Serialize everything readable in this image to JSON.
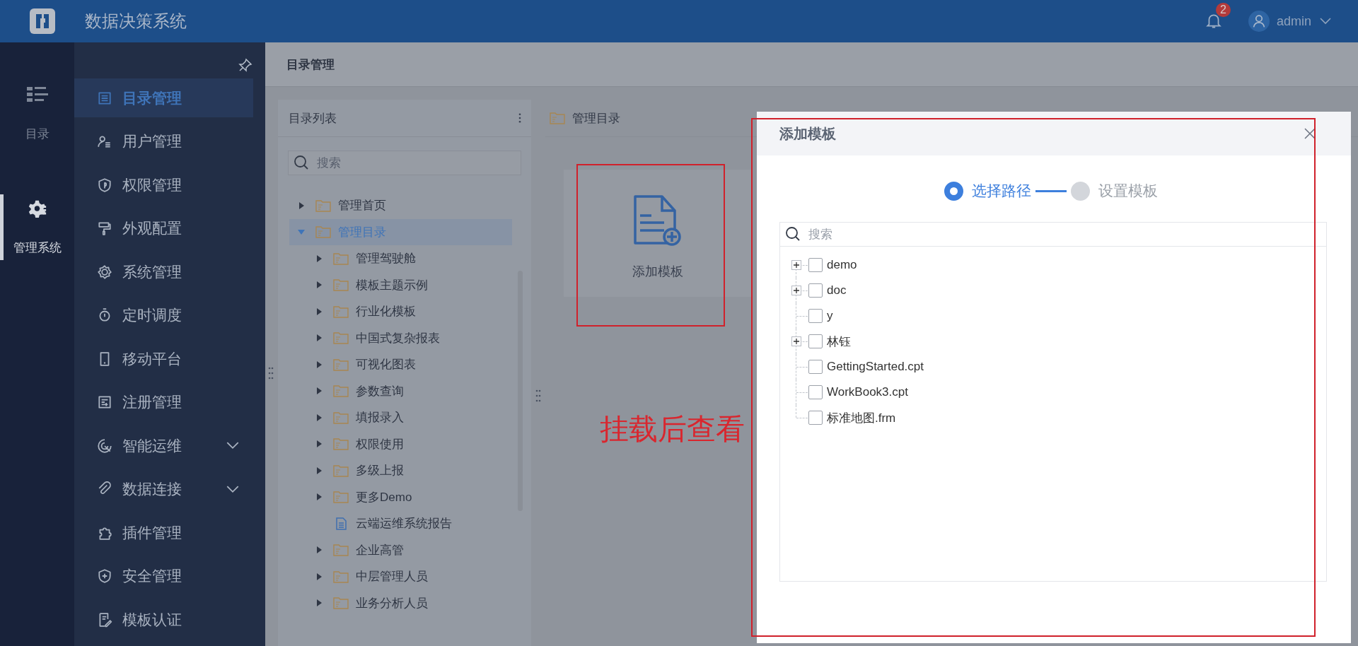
{
  "header": {
    "title": "数据决策系统",
    "notifications": "2",
    "user": "admin"
  },
  "nav_rail": [
    {
      "label": "目录",
      "selected": false
    },
    {
      "label": "管理系统",
      "selected": true
    }
  ],
  "sidebar": {
    "items": [
      {
        "label": "目录管理",
        "selected": true,
        "kind": "link"
      },
      {
        "label": "用户管理",
        "selected": false,
        "kind": "link"
      },
      {
        "label": "权限管理",
        "selected": false,
        "kind": "link"
      },
      {
        "label": "外观配置",
        "selected": false,
        "kind": "link"
      },
      {
        "label": "系统管理",
        "selected": false,
        "kind": "link"
      },
      {
        "label": "定时调度",
        "selected": false,
        "kind": "link"
      },
      {
        "label": "移动平台",
        "selected": false,
        "kind": "link"
      },
      {
        "label": "注册管理",
        "selected": false,
        "kind": "link"
      },
      {
        "label": "智能运维",
        "selected": false,
        "kind": "group"
      },
      {
        "label": "数据连接",
        "selected": false,
        "kind": "group"
      },
      {
        "label": "插件管理",
        "selected": false,
        "kind": "link"
      },
      {
        "label": "安全管理",
        "selected": false,
        "kind": "link"
      },
      {
        "label": "模板认证",
        "selected": false,
        "kind": "link"
      }
    ]
  },
  "page_title": "目录管理",
  "dir_list": {
    "title": "目录列表",
    "search": {
      "placeholder": "搜索"
    },
    "tree": [
      {
        "label": "管理首页",
        "kind": "folder",
        "expanded": false,
        "selected": false
      },
      {
        "label": "管理目录",
        "kind": "folder",
        "expanded": true,
        "selected": true,
        "children": [
          {
            "label": "管理驾驶舱",
            "kind": "folder",
            "expanded": false,
            "selected": false
          },
          {
            "label": "模板主题示例",
            "kind": "folder",
            "expanded": false,
            "selected": false
          },
          {
            "label": "行业化模板",
            "kind": "folder",
            "expanded": false,
            "selected": false
          },
          {
            "label": "中国式复杂报表",
            "kind": "folder",
            "expanded": false,
            "selected": false
          },
          {
            "label": "可视化图表",
            "kind": "folder",
            "expanded": false,
            "selected": false
          },
          {
            "label": "参数查询",
            "kind": "folder",
            "expanded": false,
            "selected": false
          },
          {
            "label": "填报录入",
            "kind": "folder",
            "expanded": false,
            "selected": false
          },
          {
            "label": "权限使用",
            "kind": "folder",
            "expanded": false,
            "selected": false
          },
          {
            "label": "多级上报",
            "kind": "folder",
            "expanded": false,
            "selected": false
          },
          {
            "label": "更多Demo",
            "kind": "folder",
            "expanded": false,
            "selected": false
          },
          {
            "label": "云端运维系统报告",
            "kind": "file",
            "selected": false
          },
          {
            "label": "企业高管",
            "kind": "folder",
            "expanded": false,
            "selected": false
          },
          {
            "label": "中层管理人员",
            "kind": "folder",
            "expanded": false,
            "selected": false
          },
          {
            "label": "业务分析人员",
            "kind": "folder",
            "expanded": false,
            "selected": false
          }
        ]
      }
    ]
  },
  "content": {
    "title": "管理目录",
    "add_card": "添加模板"
  },
  "dialog": {
    "title": "添加模板",
    "steps": [
      {
        "label": "选择路径",
        "selected": true
      },
      {
        "label": "设置模板",
        "selected": false
      }
    ],
    "search": {
      "placeholder": "搜索"
    },
    "tree": [
      {
        "label": "demo",
        "kind": "folder",
        "expanded": false,
        "checked": false
      },
      {
        "label": "doc",
        "kind": "folder",
        "expanded": false,
        "checked": false
      },
      {
        "label": "y",
        "kind": "file",
        "checked": false
      },
      {
        "label": "林钰",
        "kind": "folder",
        "expanded": false,
        "checked": false
      },
      {
        "label": "GettingStarted.cpt",
        "kind": "file",
        "checked": false
      },
      {
        "label": "WorkBook3.cpt",
        "kind": "file",
        "checked": false
      },
      {
        "label": "标准地图.frm",
        "kind": "file",
        "checked": false
      }
    ]
  },
  "annotation": {
    "text": "挂载后查看"
  }
}
